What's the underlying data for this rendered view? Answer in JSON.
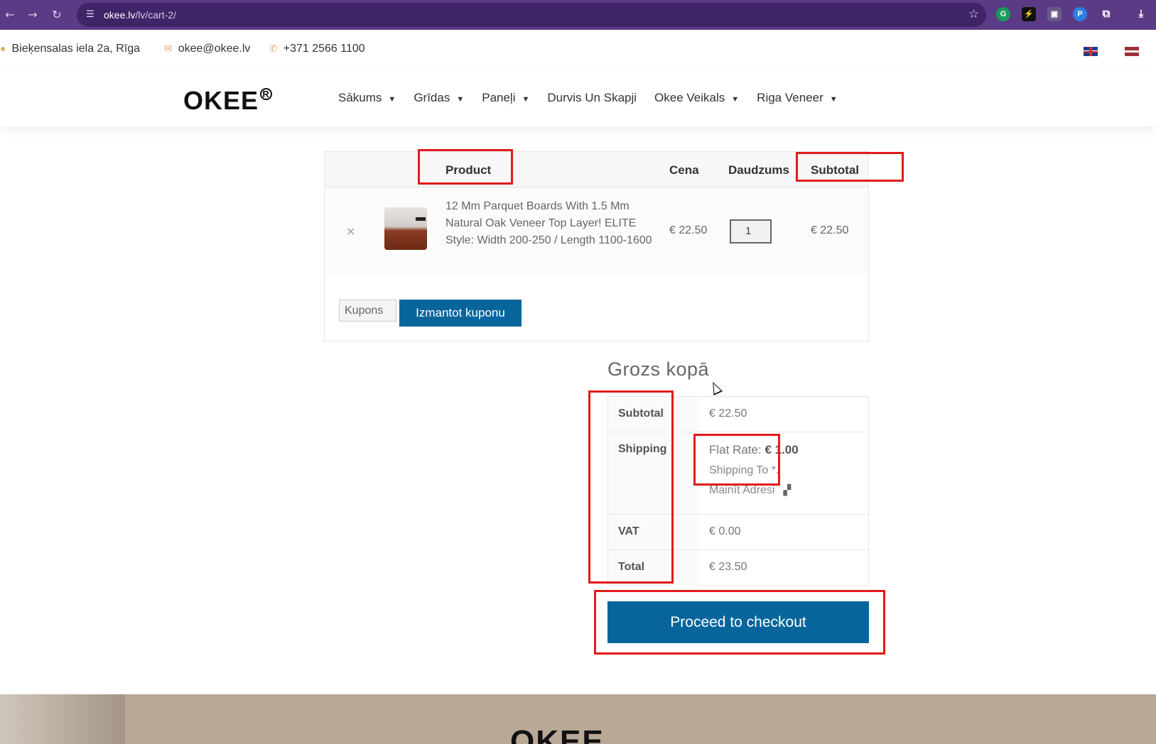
{
  "browser": {
    "url_host": "okee.lv",
    "url_path": "/lv/cart-2/"
  },
  "topbar": {
    "address": "Bieķensalas iela 2a, Rīga",
    "email": "okee@okee.lv",
    "phone": "+371 2566 1100"
  },
  "header": {
    "logo_text": "OKEE",
    "menu": [
      {
        "label": "Sākums",
        "has_dropdown": true
      },
      {
        "label": "Grīdas",
        "has_dropdown": true
      },
      {
        "label": "Paneļi",
        "has_dropdown": true
      },
      {
        "label": "Durvis Un Skapji",
        "has_dropdown": false
      },
      {
        "label": "Okee Veikals",
        "has_dropdown": true
      },
      {
        "label": "Riga Veneer",
        "has_dropdown": true
      }
    ]
  },
  "cart": {
    "columns": {
      "product": "Product",
      "price": "Cena",
      "quantity": "Daudzums",
      "subtotal": "Subtotal"
    },
    "items": [
      {
        "remove": "×",
        "name": "12 Mm Parquet Boards With 1.5 Mm Natural Oak Veneer Top Layer! ELITE Style: Width 200-250 / Length 1100-1600",
        "price": "€ 22.50",
        "quantity": "1",
        "subtotal": "€ 22.50"
      }
    ],
    "coupon_placeholder": "Kupons",
    "apply_coupon_label": "Izmantot kuponu"
  },
  "totals": {
    "title": "Grozs kopā",
    "subtotal_label": "Subtotal",
    "subtotal_value": "€ 22.50",
    "shipping_label": "Shipping",
    "shipping_method": "Flat Rate:",
    "shipping_cost": "€ 1.00",
    "shipping_to": "Shipping To *.",
    "change_address": "Mainīt Adresi",
    "vat_label": "VAT",
    "vat_value": "€ 0.00",
    "total_label": "Total",
    "total_value": "€ 23.50",
    "checkout_label": "Proceed to checkout"
  },
  "footer": {
    "logo_text": "OKEE"
  },
  "colors": {
    "browser_frame": "#5b3b86",
    "primary_button": "#08659c",
    "annotation": "#e21b1b",
    "accent_icon": "#d9ae6e"
  }
}
